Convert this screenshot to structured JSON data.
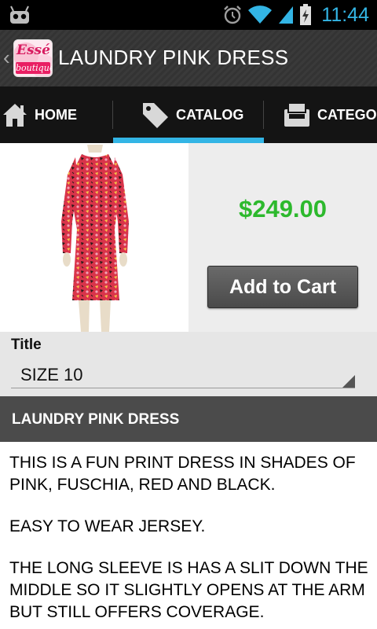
{
  "status_bar": {
    "time": "11:44",
    "icons": [
      "android-robot-icon",
      "alarm-icon",
      "wifi-icon",
      "signal-icon",
      "battery-charging-icon"
    ],
    "accent_color": "#33b5e5"
  },
  "action_bar": {
    "logo_text_top": "Essé",
    "logo_text_bottom": "boutique",
    "title": "LAUNDRY PINK DRESS"
  },
  "tabs": [
    {
      "label": "HOME",
      "icon": "home-icon",
      "selected": false
    },
    {
      "label": "CATALOG",
      "icon": "price-tag-icon",
      "selected": true
    },
    {
      "label": "CATEGOR",
      "icon": "inbox-tray-icon",
      "selected": false
    }
  ],
  "product": {
    "price": "$249.00",
    "add_to_cart_label": "Add to Cart",
    "price_color": "#2db92d"
  },
  "variant": {
    "label": "Title",
    "selected_value": "SIZE 10"
  },
  "description": {
    "heading": "LAUNDRY PINK DRESS",
    "paragraphs": [
      "THIS IS A FUN PRINT DRESS IN SHADES OF PINK, FUSCHIA, RED AND BLACK.",
      "EASY TO WEAR JERSEY.",
      "THE LONG SLEEVE IS HAS A SLIT DOWN THE MIDDLE SO IT SLIGHTLY OPENS AT THE ARM BUT STILL OFFERS COVERAGE."
    ]
  }
}
